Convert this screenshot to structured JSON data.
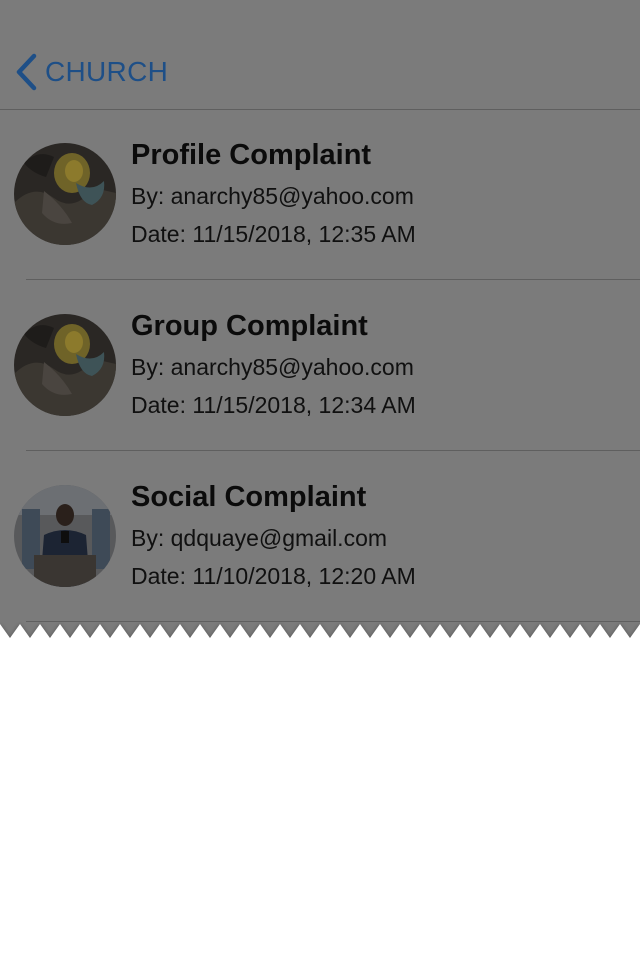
{
  "nav": {
    "back_label": "CHURCH",
    "back_icon": "chevron-left-icon"
  },
  "complaints": [
    {
      "title": "Profile Complaint",
      "by": "By: anarchy85@yahoo.com",
      "date": "Date: 11/15/2018, 12:35 AM",
      "avatar": "fantasy-art-avatar"
    },
    {
      "title": "Group Complaint",
      "by": "By: anarchy85@yahoo.com",
      "date": "Date: 11/15/2018, 12:34 AM",
      "avatar": "fantasy-art-avatar"
    },
    {
      "title": "Social Complaint",
      "by": "By: qdquaye@gmail.com",
      "date": "Date: 11/10/2018, 12:20 AM",
      "avatar": "mirror-selfie-avatar"
    }
  ],
  "colors": {
    "overlay_gray": "#7b7b7b",
    "accent_blue": "#1e4f87",
    "divider": "#5f5f5f",
    "background": "#ffffff"
  }
}
